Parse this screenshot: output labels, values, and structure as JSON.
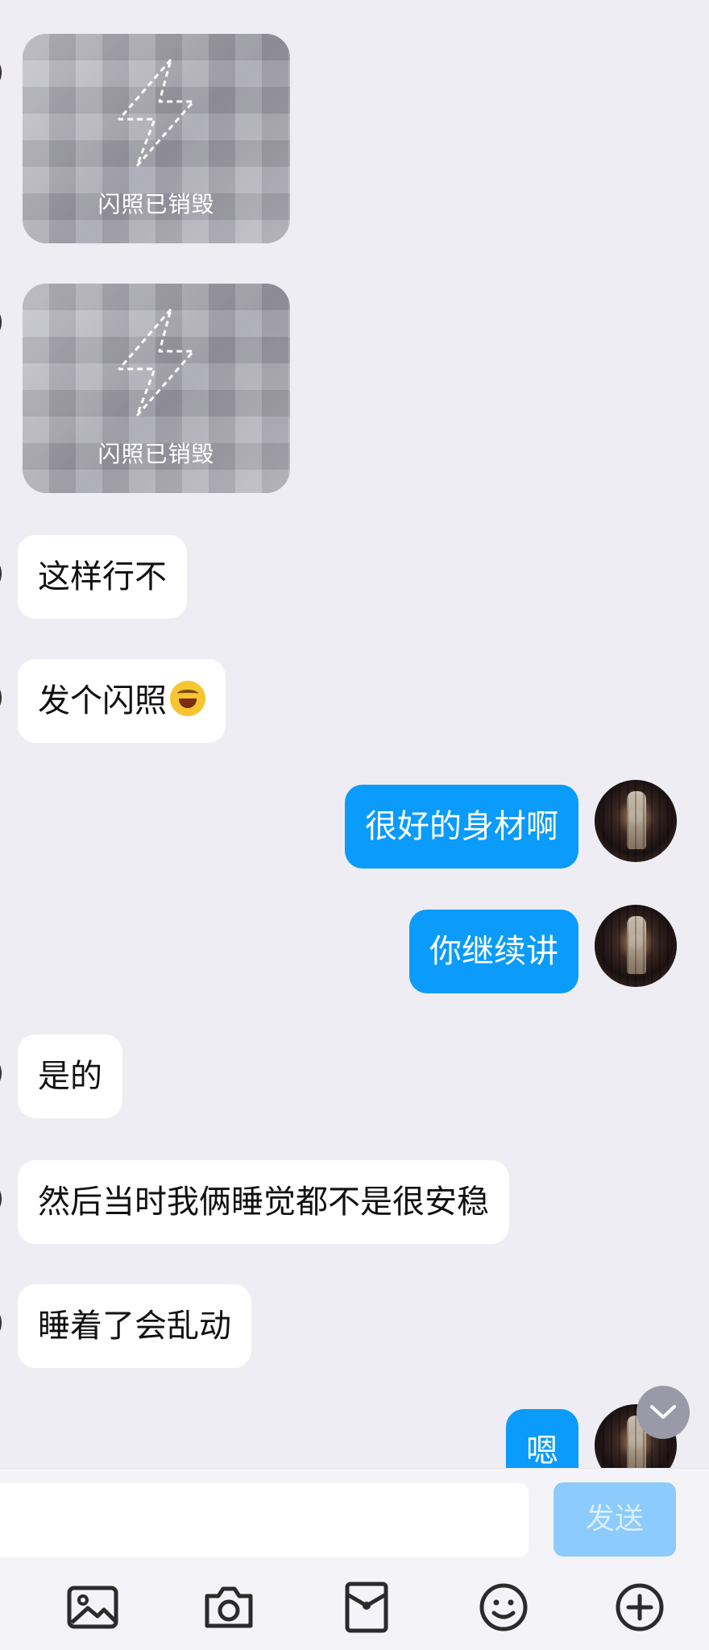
{
  "flash_label": "闪照已销毁",
  "messages": {
    "m1": "这样行不",
    "m2": "发个闪照",
    "m3": "很好的身材啊",
    "m4": "你继续讲",
    "m5": "是的",
    "m6": "然后当时我俩睡觉都不是很安稳",
    "m7": "睡着了会乱动",
    "m8": "嗯"
  },
  "input": {
    "send_label": "发送",
    "value": ""
  },
  "toolbar": [
    "image-icon",
    "camera-icon",
    "red-packet-icon",
    "emoji-icon",
    "plus-icon"
  ],
  "colors": {
    "background": "#eeedf3",
    "outgoing_bubble": "#0a9bfb",
    "incoming_bubble": "#ffffff",
    "send_button_disabled": "#8ccbfb"
  }
}
